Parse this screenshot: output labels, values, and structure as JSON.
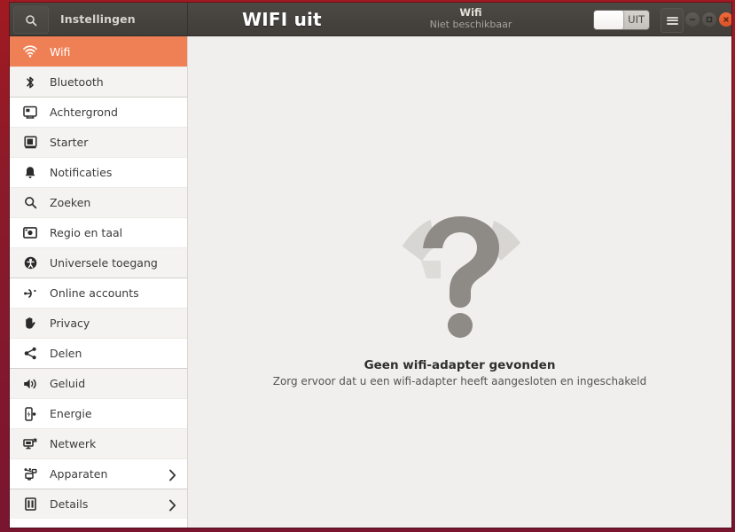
{
  "window": {
    "app_title": "Instellingen",
    "overlay_annotation": "WIFI uit",
    "frame_color": "#8b1a2a",
    "header_color": "#46433f",
    "accent_color": "#ef8055"
  },
  "titlebar": {
    "search_icon": "search-icon",
    "panel_title": "Wifi",
    "panel_subtitle": "Niet beschikbaar",
    "toggle_label": "UIT",
    "toggle_state": "off",
    "menu_icon": "hamburger-icon",
    "minimize_icon": "minimize-icon",
    "maximize_icon": "maximize-icon",
    "close_icon": "close-icon"
  },
  "sidebar": {
    "items": [
      {
        "label": "Wifi",
        "icon": "wifi-icon",
        "selected": true,
        "group_start": false,
        "chevron": false
      },
      {
        "label": "Bluetooth",
        "icon": "bluetooth-icon",
        "selected": false,
        "group_start": false,
        "chevron": false
      },
      {
        "label": "Achtergrond",
        "icon": "background-icon",
        "selected": false,
        "group_start": true,
        "chevron": false
      },
      {
        "label": "Starter",
        "icon": "launcher-icon",
        "selected": false,
        "group_start": false,
        "chevron": false
      },
      {
        "label": "Notificaties",
        "icon": "bell-icon",
        "selected": false,
        "group_start": false,
        "chevron": false
      },
      {
        "label": "Zoeken",
        "icon": "search-icon",
        "selected": false,
        "group_start": false,
        "chevron": false
      },
      {
        "label": "Regio en taal",
        "icon": "region-icon",
        "selected": false,
        "group_start": false,
        "chevron": false
      },
      {
        "label": "Universele toegang",
        "icon": "accessibility-icon",
        "selected": false,
        "group_start": false,
        "chevron": false
      },
      {
        "label": "Online accounts",
        "icon": "online-accounts-icon",
        "selected": false,
        "group_start": true,
        "chevron": false
      },
      {
        "label": "Privacy",
        "icon": "privacy-hand-icon",
        "selected": false,
        "group_start": false,
        "chevron": false
      },
      {
        "label": "Delen",
        "icon": "sharing-icon",
        "selected": false,
        "group_start": false,
        "chevron": false
      },
      {
        "label": "Geluid",
        "icon": "sound-icon",
        "selected": false,
        "group_start": true,
        "chevron": false
      },
      {
        "label": "Energie",
        "icon": "power-icon",
        "selected": false,
        "group_start": false,
        "chevron": false
      },
      {
        "label": "Netwerk",
        "icon": "network-icon",
        "selected": false,
        "group_start": false,
        "chevron": false
      },
      {
        "label": "Apparaten",
        "icon": "devices-icon",
        "selected": false,
        "group_start": false,
        "chevron": true
      },
      {
        "label": "Details",
        "icon": "details-icon",
        "selected": false,
        "group_start": true,
        "chevron": true
      }
    ]
  },
  "content": {
    "empty_icon": "question-mark-wifi-icon",
    "empty_title": "Geen wifi-adapter gevonden",
    "empty_desc": "Zorg ervoor dat u een wifi-adapter heeft aangesloten en ingeschakeld"
  }
}
